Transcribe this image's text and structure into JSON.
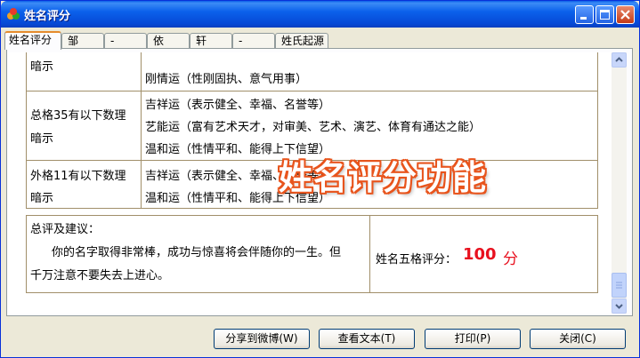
{
  "window": {
    "title": "姓名评分"
  },
  "tabs": [
    {
      "label": "姓名评分",
      "active": true
    },
    {
      "label": "邹"
    },
    {
      "label": "-"
    },
    {
      "label": "依"
    },
    {
      "label": "轩"
    },
    {
      "label": "-"
    },
    {
      "label": "姓氏起源"
    }
  ],
  "table": {
    "row1": {
      "left": "暗示",
      "partial_top": "",
      "line": "刚情运（性刚固执、意气用事）"
    },
    "row2": {
      "left1": "总格35有以下数理",
      "left2": "暗示",
      "lines": [
        "吉祥运（表示健全、幸福、名誉等）",
        "艺能运（富有艺术天才，对审美、艺术、演艺、体育有通达之能）",
        "温和运（性情平和、能得上下信望）"
      ]
    },
    "row3": {
      "left1": "外格11有以下数理",
      "left2": "暗示",
      "lines": [
        "吉祥运（表示健全、幸福、名誉等）",
        "温和运（性情平和、能得上下信望）"
      ]
    }
  },
  "summary": {
    "heading": "总评及建议：",
    "text1": "你的名字取得非常棒，成功与惊喜将会伴随你的一生。但",
    "text2": "千万注意不要失去上进心。",
    "score_label": "姓名五格评分：",
    "score_value": "100",
    "score_unit": "分"
  },
  "overlay": {
    "caption": "姓名评分功能"
  },
  "buttons": {
    "share": "分享到微博(W)",
    "view_text": "查看文本(T)",
    "print": "打印(P)",
    "close": "关闭(C)"
  },
  "colors": {
    "accent": "#e8101e",
    "titlebar": "#0b61eb",
    "watermark_outline": "#e8541c"
  }
}
